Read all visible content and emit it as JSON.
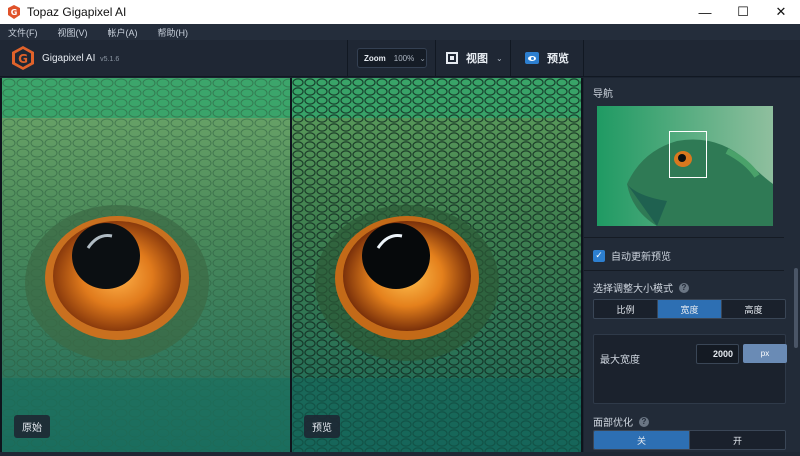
{
  "window": {
    "title": "Topaz Gigapixel AI",
    "minimize": "—",
    "maximize": "☐",
    "close": "✕"
  },
  "menu": {
    "items": [
      "文件(F)",
      "视图(V)",
      "帐户(A)",
      "帮助(H)"
    ]
  },
  "toolbar": {
    "brand": "Gigapixel AI",
    "version": "v5.1.6",
    "zoom_label": "Zoom",
    "zoom_value": "100%",
    "view_label": "视图",
    "preview_label": "预览"
  },
  "viewer": {
    "left_label": "原始",
    "right_label": "预览"
  },
  "sidepanel": {
    "navigation_title": "导航",
    "auto_update_label": "自动更新预览",
    "auto_update_checked": true,
    "resize_mode_title": "选择调整大小模式",
    "resize_modes": [
      "比例",
      "宽度",
      "高度"
    ],
    "resize_mode_active": "宽度",
    "max_width_label": "最大宽度",
    "max_width_value": "2000",
    "unit": "px",
    "face_refinement_title": "面部优化",
    "face_options": [
      "关",
      "开"
    ],
    "face_active": "关"
  },
  "colors": {
    "accent": "#2d6fb3",
    "background": "#1b2330",
    "panel": "#222b38"
  }
}
